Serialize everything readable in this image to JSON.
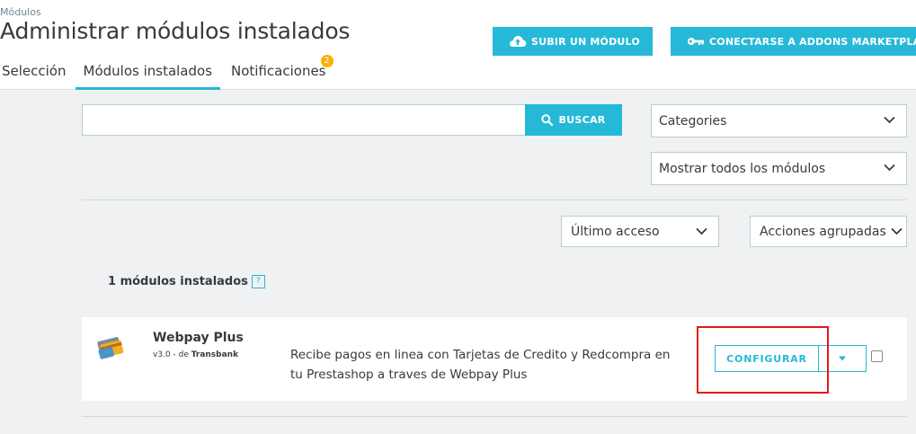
{
  "header": {
    "breadcrumb": "Módulos",
    "title": "Administrar módulos instalados",
    "upload_button": "SUBIR UN MÓDULO",
    "upload_icon": "cloud-upload-icon",
    "connect_button": "CONECTARSE A ADDONS MARKETPLACE",
    "connect_icon": "key-icon"
  },
  "tabs": [
    {
      "label": "Selección"
    },
    {
      "label": "Módulos instalados",
      "active": true
    },
    {
      "label": "Notificaciones",
      "badge": "2"
    }
  ],
  "search": {
    "placeholder": "",
    "button_label": "BUSCAR",
    "button_icon": "search-icon"
  },
  "filters": {
    "categories": "Categories",
    "show": "Mostrar todos los módulos",
    "sort": "Último acceso",
    "bulk_actions": "Acciones agrupadas"
  },
  "list": {
    "count_label": "1 módulos instalados",
    "help_label": "?",
    "modules": [
      {
        "name": "Webpay Plus",
        "version": "v3.0 - de ",
        "author": "Transbank",
        "description": "Recibe pagos en linea con Tarjetas de Credito y Redcompra en tu Prestashop a traves de Webpay Plus",
        "configure_label": "CONFIGURAR",
        "logo_icon": "credit-cards-icon"
      }
    ]
  },
  "colors": {
    "accent": "#25b9d7",
    "badge": "#fab000",
    "highlight": "#e8161c",
    "background": "#eff1f2"
  }
}
